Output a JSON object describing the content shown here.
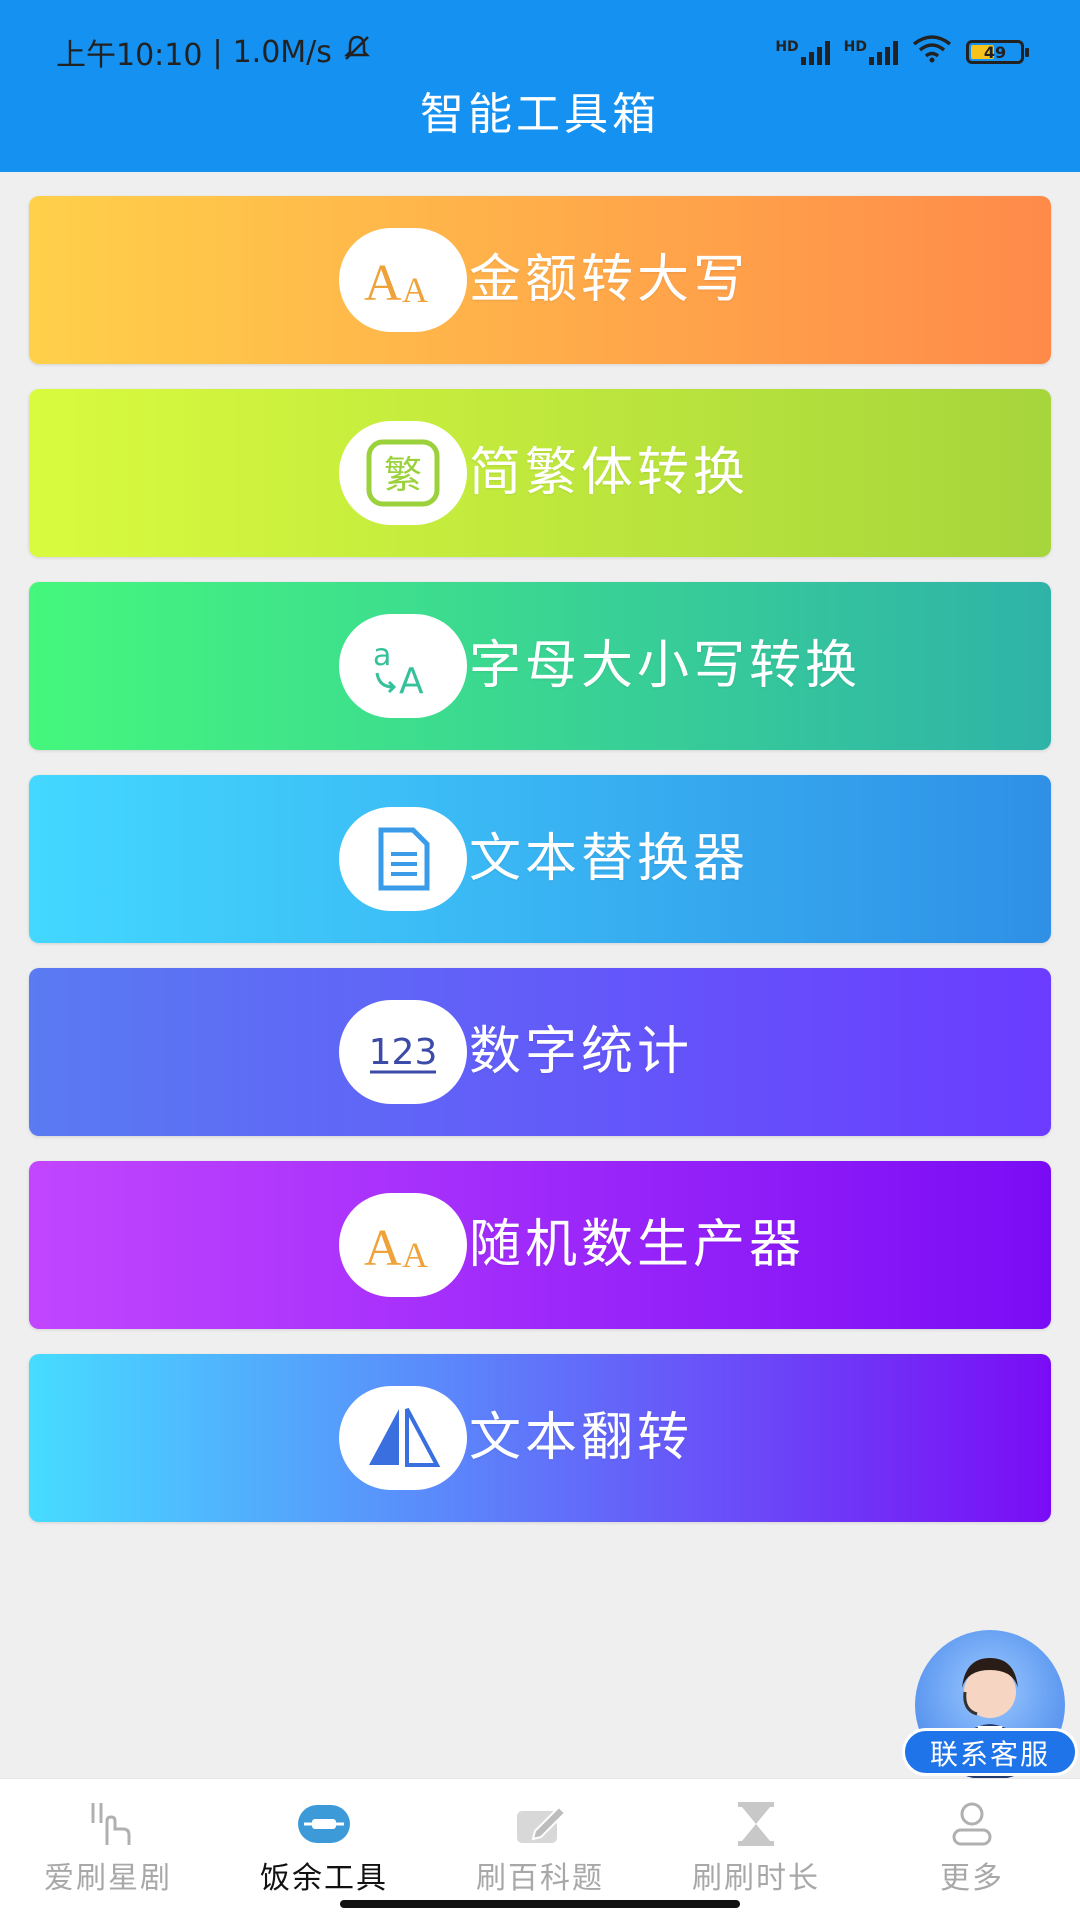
{
  "status_bar": {
    "time": "上午10:10",
    "speed": "1.0M/s",
    "hd1": "HD",
    "hd2": "HD",
    "battery": "49"
  },
  "header": {
    "title": "智能工具箱"
  },
  "tools": [
    {
      "label": "金额转大写",
      "icon": "font-aa-icon"
    },
    {
      "label": "简繁体转换",
      "icon": "traditional-char-icon"
    },
    {
      "label": "字母大小写转换",
      "icon": "letter-case-icon"
    },
    {
      "label": "文本替换器",
      "icon": "document-icon"
    },
    {
      "label": "数字统计",
      "icon": "number-123-icon"
    },
    {
      "label": "随机数生产器",
      "icon": "font-aa-icon"
    },
    {
      "label": "文本翻转",
      "icon": "flip-triangle-icon"
    }
  ],
  "icon_text": {
    "aa_big": "A",
    "aa_small": "A",
    "fan": "繁",
    "case_a": "a",
    "case_A": "A",
    "num": "123"
  },
  "service": {
    "label": "联系客服"
  },
  "tabs": [
    {
      "label": "爱刷星剧",
      "active": false
    },
    {
      "label": "饭余工具",
      "active": true
    },
    {
      "label": "刷百科题",
      "active": false
    },
    {
      "label": "刷刷时长",
      "active": false
    },
    {
      "label": "更多",
      "active": false
    }
  ],
  "colors": {
    "header": "#1591f1",
    "tab_active": "#111111",
    "tab_inactive": "#a8a8a8",
    "service": "#1e74e8"
  }
}
